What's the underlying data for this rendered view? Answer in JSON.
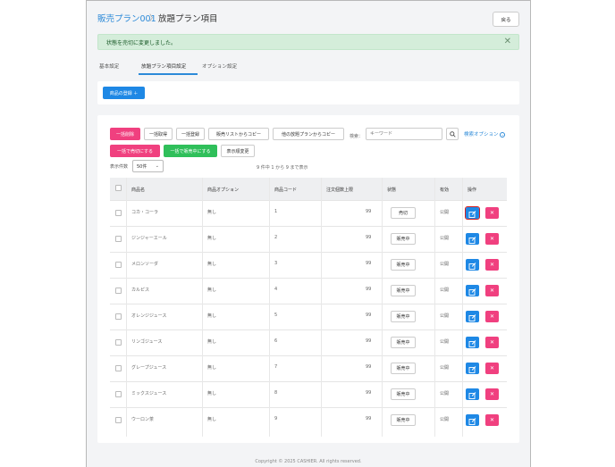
{
  "header": {
    "breadcrumb_link": "販売プラン001",
    "breadcrumb_sep": "〉",
    "page_title": "放題プラン項目",
    "back_label": "戻る"
  },
  "alert": {
    "message": "状態を売切に変更しました。",
    "close": "✕"
  },
  "tabs": [
    "基本設定",
    "放題プラン項目設定",
    "オプション設定"
  ],
  "register_button": "商品の登録 ＋",
  "toolbar": {
    "bulk_delete": "一括削除",
    "bulk_get": "一括取得",
    "bulk_register": "一括登録",
    "copy_from_sales_list": "販売リストからコピー",
    "copy_from_other_plan": "他の放題プランからコピー",
    "search_label": "検索：",
    "search_placeholder": "キーワード",
    "advanced_search": "検索オプション",
    "bulk_sold_out": "一括で売切にする",
    "bulk_on_sale": "一括で販売中にする",
    "reorder": "表示順変更"
  },
  "pagination": {
    "per_page_label": "表示件数",
    "per_page_value": "50件",
    "range_text": "9 件中 1 から 9 まで表示"
  },
  "table": {
    "headers": [
      "商品名",
      "商品オプション",
      "商品コード",
      "注文個数上限",
      "状態",
      "有効",
      "操作"
    ],
    "rows": [
      {
        "name": "コカ・コーラ",
        "option": "無し",
        "code": "1",
        "limit": "99",
        "status": "売切",
        "enabled": "公開"
      },
      {
        "name": "ジンジャーエール",
        "option": "無し",
        "code": "2",
        "limit": "99",
        "status": "販売中",
        "enabled": "公開"
      },
      {
        "name": "メロンソーダ",
        "option": "無し",
        "code": "3",
        "limit": "99",
        "status": "販売中",
        "enabled": "公開"
      },
      {
        "name": "カルピス",
        "option": "無し",
        "code": "4",
        "limit": "99",
        "status": "販売中",
        "enabled": "公開"
      },
      {
        "name": "オレンジジュース",
        "option": "無し",
        "code": "5",
        "limit": "99",
        "status": "販売中",
        "enabled": "公開"
      },
      {
        "name": "リンゴジュース",
        "option": "無し",
        "code": "6",
        "limit": "99",
        "status": "販売中",
        "enabled": "公開"
      },
      {
        "name": "グレープジュース",
        "option": "無し",
        "code": "7",
        "limit": "99",
        "status": "販売中",
        "enabled": "公開"
      },
      {
        "name": "ミックスジュース",
        "option": "無し",
        "code": "8",
        "limit": "99",
        "status": "販売中",
        "enabled": "公開"
      },
      {
        "name": "ウーロン茶",
        "option": "無し",
        "code": "9",
        "limit": "99",
        "status": "販売中",
        "enabled": "公開"
      }
    ]
  },
  "footer": "Copyright © 2025 CASHIER. All rights reserved.",
  "colors": {
    "accent": "#1e88e5",
    "danger": "#f0407f",
    "success": "#2fbf5a",
    "alert_bg": "#d4edda"
  }
}
